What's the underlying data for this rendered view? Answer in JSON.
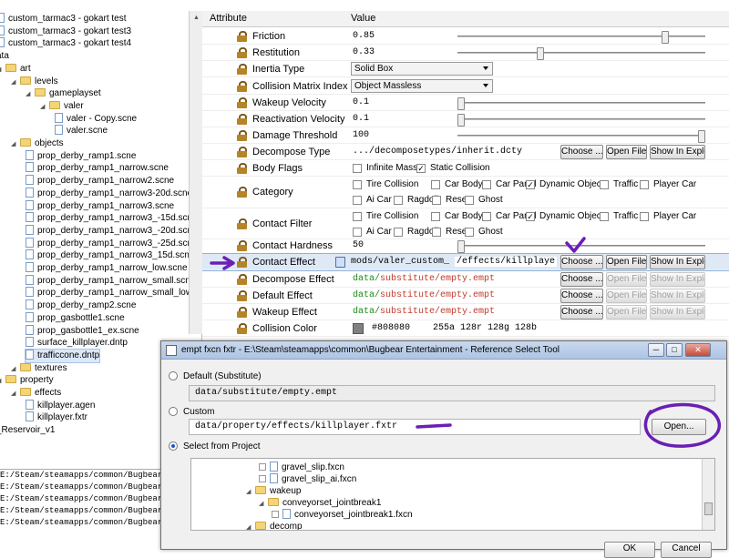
{
  "tree": {
    "items": [
      {
        "label": "custom_tarmac3 - gokart test",
        "type": "file",
        "indent": 0
      },
      {
        "label": "custom_tarmac3 - gokart test3",
        "type": "file",
        "indent": 0
      },
      {
        "label": "custom_tarmac3 - gokart test4",
        "type": "file",
        "indent": 0
      },
      {
        "label": "ata",
        "type": "text",
        "indent": 0
      },
      {
        "label": "art",
        "type": "folder",
        "indent": 0
      },
      {
        "label": "levels",
        "type": "folder",
        "indent": 1
      },
      {
        "label": "gameplayset",
        "type": "folder",
        "indent": 2
      },
      {
        "label": "valer",
        "type": "folder",
        "indent": 3
      },
      {
        "label": "valer - Copy.scne",
        "type": "file",
        "indent": 4
      },
      {
        "label": "valer.scne",
        "type": "file",
        "indent": 4
      },
      {
        "label": "objects",
        "type": "folder",
        "indent": 1
      },
      {
        "label": "prop_derby_ramp1.scne",
        "type": "file",
        "indent": 2
      },
      {
        "label": "prop_derby_ramp1_narrow.scne",
        "type": "file",
        "indent": 2
      },
      {
        "label": "prop_derby_ramp1_narrow2.scne",
        "type": "file",
        "indent": 2
      },
      {
        "label": "prop_derby_ramp1_narrow3-20d.scne",
        "type": "file",
        "indent": 2
      },
      {
        "label": "prop_derby_ramp1_narrow3.scne",
        "type": "file",
        "indent": 2
      },
      {
        "label": "prop_derby_ramp1_narrow3_-15d.scne",
        "type": "file",
        "indent": 2
      },
      {
        "label": "prop_derby_ramp1_narrow3_-20d.scne",
        "type": "file",
        "indent": 2
      },
      {
        "label": "prop_derby_ramp1_narrow3_-25d.scne",
        "type": "file",
        "indent": 2
      },
      {
        "label": "prop_derby_ramp1_narrow3_15d.scne",
        "type": "file",
        "indent": 2
      },
      {
        "label": "prop_derby_ramp1_narrow_low.scne",
        "type": "file",
        "indent": 2
      },
      {
        "label": "prop_derby_ramp1_narrow_small.scne",
        "type": "file",
        "indent": 2
      },
      {
        "label": "prop_derby_ramp1_narrow_small_low.s...",
        "type": "file",
        "indent": 2
      },
      {
        "label": "prop_derby_ramp2.scne",
        "type": "file",
        "indent": 2
      },
      {
        "label": "prop_gasbottle1.scne",
        "type": "file",
        "indent": 2
      },
      {
        "label": "prop_gasbottle1_ex.scne",
        "type": "file",
        "indent": 2
      },
      {
        "label": "surface_killplayer.dntp",
        "type": "file",
        "indent": 2
      },
      {
        "label": "trafficcone.dntp",
        "type": "file",
        "indent": 2,
        "selected": true
      },
      {
        "label": "textures",
        "type": "folder",
        "indent": 1
      },
      {
        "label": "property",
        "type": "folder",
        "indent": 0
      },
      {
        "label": "effects",
        "type": "folder",
        "indent": 1
      },
      {
        "label": "killplayer.agen",
        "type": "file",
        "indent": 2
      },
      {
        "label": "killplayer.fxtr",
        "type": "file",
        "indent": 2
      },
      {
        "label": "_Reservoir_v1",
        "type": "text",
        "indent": 0
      }
    ]
  },
  "console": {
    "lines": [
      "E:/Steam/steamapps/common/Bugbear Ent",
      "E:/Steam/steamapps/common/Bugbear Ente",
      " E:/Steam/steamapps/common/Bugbear",
      " E:/Steam/steamapps/common/Bugbear",
      "E:/Steam/steamapps/common/Bugbear Ente"
    ]
  },
  "grid": {
    "col_attribute": "Attribute",
    "col_value": "Value",
    "choose_label": "Choose ...",
    "open_file_label": "Open File",
    "show_in_explorer_label": "Show In Explo",
    "rows": {
      "friction": {
        "name": "Friction",
        "value": "0.85",
        "slider": 0.85
      },
      "restitution": {
        "name": "Restitution",
        "value": "0.33",
        "slider": 0.33
      },
      "inertia": {
        "name": "Inertia Type",
        "value": "Solid Box"
      },
      "collision_matrix": {
        "name": "Collision Matrix Index",
        "value": "Object Massless"
      },
      "wakeup_velocity": {
        "name": "Wakeup Velocity",
        "value": "0.1",
        "slider": 0.0
      },
      "reactivation_velocity": {
        "name": "Reactivation Velocity",
        "value": "0.1",
        "slider": 0.0
      },
      "damage_threshold": {
        "name": "Damage Threshold",
        "value": "100",
        "slider": 1.0
      },
      "decompose_type": {
        "name": "Decompose Type",
        "value": ".../decomposetypes/inherit.dcty"
      },
      "body_flags": {
        "name": "Body Flags",
        "options": [
          {
            "label": "Infinite Mass",
            "checked": false
          },
          {
            "label": "Static Collision",
            "checked": true
          }
        ]
      },
      "category": {
        "name": "Category",
        "line1": [
          {
            "label": "Tire Collision",
            "checked": false
          },
          {
            "label": "Car Body",
            "checked": false
          },
          {
            "label": "Car Panel",
            "checked": false
          },
          {
            "label": "Dynamic Object",
            "checked": true
          },
          {
            "label": "Traffic",
            "checked": false
          },
          {
            "label": "Player Car",
            "checked": false
          }
        ],
        "line2": [
          {
            "label": "Ai Car",
            "checked": false
          },
          {
            "label": "Ragdoll",
            "checked": false
          },
          {
            "label": "Reset",
            "checked": false
          },
          {
            "label": "Ghost",
            "checked": false
          }
        ]
      },
      "contact_filter": {
        "name": "Contact Filter",
        "line1": [
          {
            "label": "Tire Collision",
            "checked": false
          },
          {
            "label": "Car Body",
            "checked": false
          },
          {
            "label": "Car Panel",
            "checked": false
          },
          {
            "label": "Dynamic Object",
            "checked": true
          },
          {
            "label": "Traffic",
            "checked": false
          },
          {
            "label": "Player Car",
            "checked": false
          }
        ],
        "line2": [
          {
            "label": "Ai Car",
            "checked": false
          },
          {
            "label": "Ragdoll",
            "checked": false
          },
          {
            "label": "Reset",
            "checked": false
          },
          {
            "label": "Ghost",
            "checked": false
          }
        ]
      },
      "contact_hardness": {
        "name": "Contact Hardness",
        "value": "50",
        "slider": 0.0
      },
      "contact_effect": {
        "name": "Contact Effect",
        "value": "mods/valer_custom_",
        "value2": "/effects/killplaye"
      },
      "decompose_effect": {
        "name": "Decompose Effect",
        "prefix": "data/",
        "path": "substitute/empty.empt"
      },
      "default_effect": {
        "name": "Default Effect",
        "prefix": "data/",
        "path": "substitute/empty.empt"
      },
      "wakeup_effect": {
        "name": "Wakeup Effect",
        "prefix": "data/",
        "path": "substitute/empty.empt"
      },
      "collision_color": {
        "name": "Collision Color",
        "hex": "#808080",
        "rgb": "255a 128r 128g 128b",
        "color": "#808080"
      }
    }
  },
  "dialog": {
    "title": "empt fxcn fxtr - E:\\Steam\\steamapps\\common\\Bugbear Entertainment - Reference Select Tool",
    "default_label": "Default (Substitute)",
    "default_value": "data/substitute/empty.empt",
    "custom_label": "Custom",
    "custom_value": "data/property/effects/killplayer.fxtr",
    "open_label": "Open...",
    "project_label": "Select from Project",
    "ok_label": "OK",
    "cancel_label": "Cancel",
    "project_tree": [
      {
        "label": "gravel_slip.fxcn",
        "kind": "file",
        "indent": 1
      },
      {
        "label": "gravel_slip_ai.fxcn",
        "kind": "file",
        "indent": 1
      },
      {
        "label": "wakeup",
        "kind": "folder",
        "indent": 0
      },
      {
        "label": "conveyorset_jointbreak1",
        "kind": "folder",
        "indent": 1
      },
      {
        "label": "conveyorset_jointbreak1.fxcn",
        "kind": "file",
        "indent": 2
      },
      {
        "label": "decomp",
        "kind": "folder",
        "indent": 0
      }
    ]
  },
  "annotation_color": "#6a1fb5"
}
